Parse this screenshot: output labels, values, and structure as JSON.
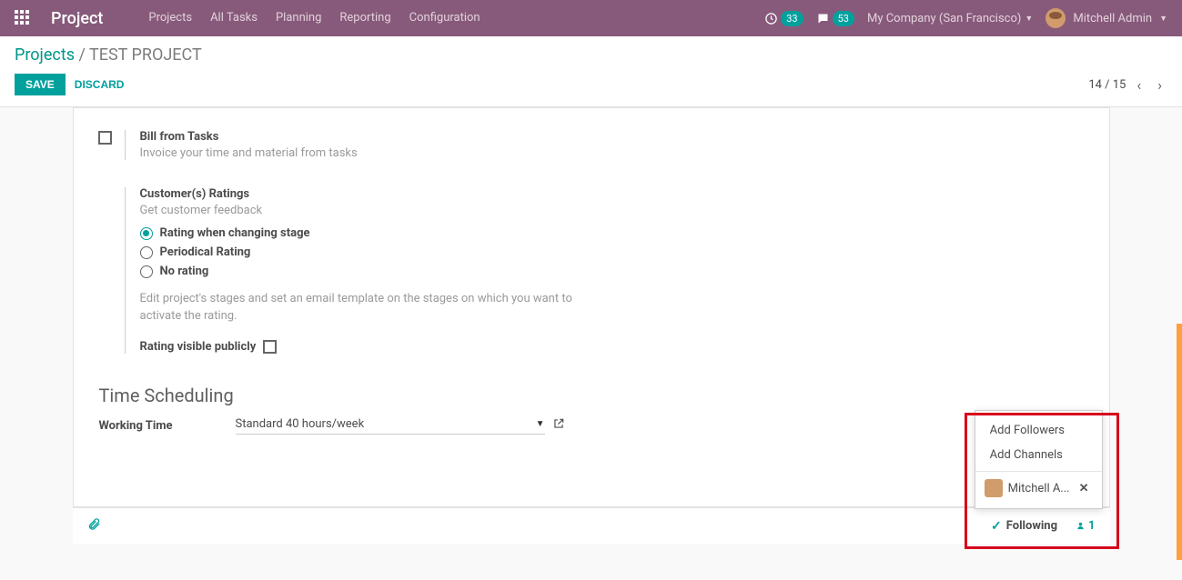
{
  "navbar": {
    "brand": "Project",
    "items": [
      "Projects",
      "All Tasks",
      "Planning",
      "Reporting",
      "Configuration"
    ],
    "activity_count": "33",
    "msg_count": "53",
    "company": "My Company (San Francisco)",
    "user": "Mitchell Admin"
  },
  "breadcrumb": {
    "root": "Projects",
    "current": "TEST PROJECT"
  },
  "buttons": {
    "save": "SAVE",
    "discard": "DISCARD"
  },
  "pager": {
    "text": "14 / 15"
  },
  "settings": {
    "bill": {
      "title": "Bill from Tasks",
      "desc": "Invoice your time and material from tasks"
    },
    "ratings": {
      "title": "Customer(s) Ratings",
      "desc": "Get customer feedback",
      "opt1": "Rating when changing stage",
      "opt2": "Periodical Rating",
      "opt3": "No rating",
      "note": "Edit project's stages and set an email template on the stages on which you want to activate the rating.",
      "public_label": "Rating visible publicly"
    }
  },
  "scheduling": {
    "heading": "Time Scheduling",
    "field_label": "Working Time",
    "field_value": "Standard 40 hours/week"
  },
  "followers": {
    "add_followers": "Add Followers",
    "add_channels": "Add Channels",
    "follower_name": "Mitchell A...",
    "following_label": "Following",
    "count": "1"
  }
}
